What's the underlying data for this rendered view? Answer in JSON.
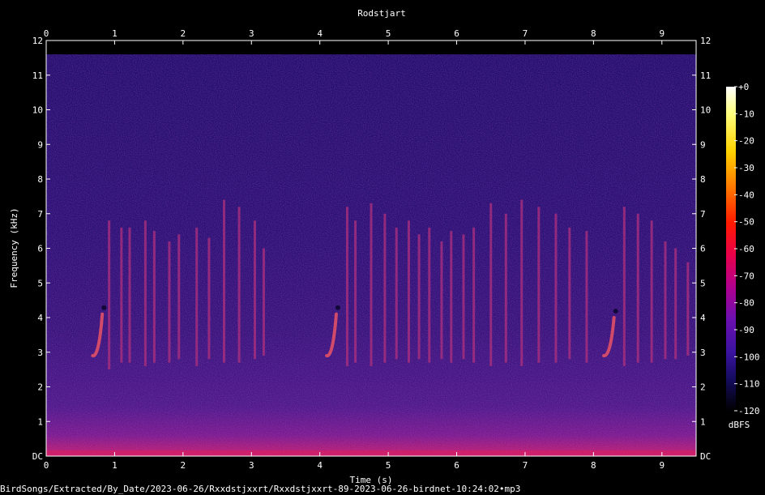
{
  "chart_data": {
    "type": "heatmap",
    "title": "Rodstjart",
    "xlabel": "Time (s)",
    "ylabel": "Frequency (kHz)",
    "xlim": [
      0,
      9.5
    ],
    "ylim": [
      0,
      12
    ],
    "x_ticks": [
      "0",
      "1",
      "2",
      "3",
      "4",
      "5",
      "6",
      "7",
      "8",
      "9"
    ],
    "y_ticks": [
      "DC",
      "1",
      "2",
      "3",
      "4",
      "5",
      "6",
      "7",
      "8",
      "9",
      "10",
      "11",
      "12"
    ],
    "colorbar": {
      "label": "dBFS",
      "ticks": [
        "+0",
        "-10",
        "-20",
        "-30",
        "-40",
        "-50",
        "-60",
        "-70",
        "-80",
        "-90",
        "-100",
        "-110",
        "-120"
      ],
      "range": [
        -120,
        0
      ]
    },
    "energy_cutoff_khz": 11.6,
    "sweeps": [
      {
        "t_start": 0.68,
        "t_end": 0.82,
        "f_start_khz": 2.9,
        "f_end_khz": 4.1
      },
      {
        "t_start": 4.1,
        "t_end": 4.24,
        "f_start_khz": 2.9,
        "f_end_khz": 4.1
      },
      {
        "t_start": 8.15,
        "t_end": 8.3,
        "f_start_khz": 2.9,
        "f_end_khz": 4.0
      }
    ],
    "clicks": [
      {
        "t": 0.92,
        "f_low_khz": 2.5,
        "f_high_khz": 6.8
      },
      {
        "t": 1.1,
        "f_low_khz": 2.7,
        "f_high_khz": 6.6
      },
      {
        "t": 1.22,
        "f_low_khz": 2.7,
        "f_high_khz": 6.6
      },
      {
        "t": 1.45,
        "f_low_khz": 2.6,
        "f_high_khz": 6.8
      },
      {
        "t": 1.58,
        "f_low_khz": 2.7,
        "f_high_khz": 6.5
      },
      {
        "t": 1.8,
        "f_low_khz": 2.7,
        "f_high_khz": 6.2
      },
      {
        "t": 1.94,
        "f_low_khz": 2.8,
        "f_high_khz": 6.4
      },
      {
        "t": 2.2,
        "f_low_khz": 2.6,
        "f_high_khz": 6.6
      },
      {
        "t": 2.38,
        "f_low_khz": 2.8,
        "f_high_khz": 6.3
      },
      {
        "t": 2.6,
        "f_low_khz": 2.7,
        "f_high_khz": 7.4
      },
      {
        "t": 2.82,
        "f_low_khz": 2.7,
        "f_high_khz": 7.2
      },
      {
        "t": 3.05,
        "f_low_khz": 2.8,
        "f_high_khz": 6.8
      },
      {
        "t": 3.18,
        "f_low_khz": 2.9,
        "f_high_khz": 6.0
      },
      {
        "t": 4.4,
        "f_low_khz": 2.6,
        "f_high_khz": 7.2
      },
      {
        "t": 4.52,
        "f_low_khz": 2.7,
        "f_high_khz": 6.8
      },
      {
        "t": 4.75,
        "f_low_khz": 2.6,
        "f_high_khz": 7.3
      },
      {
        "t": 4.95,
        "f_low_khz": 2.7,
        "f_high_khz": 7.0
      },
      {
        "t": 5.12,
        "f_low_khz": 2.8,
        "f_high_khz": 6.6
      },
      {
        "t": 5.3,
        "f_low_khz": 2.7,
        "f_high_khz": 6.8
      },
      {
        "t": 5.45,
        "f_low_khz": 2.8,
        "f_high_khz": 6.4
      },
      {
        "t": 5.6,
        "f_low_khz": 2.7,
        "f_high_khz": 6.6
      },
      {
        "t": 5.78,
        "f_low_khz": 2.8,
        "f_high_khz": 6.2
      },
      {
        "t": 5.92,
        "f_low_khz": 2.7,
        "f_high_khz": 6.5
      },
      {
        "t": 6.1,
        "f_low_khz": 2.8,
        "f_high_khz": 6.4
      },
      {
        "t": 6.25,
        "f_low_khz": 2.7,
        "f_high_khz": 6.6
      },
      {
        "t": 6.5,
        "f_low_khz": 2.6,
        "f_high_khz": 7.3
      },
      {
        "t": 6.72,
        "f_low_khz": 2.7,
        "f_high_khz": 7.0
      },
      {
        "t": 6.95,
        "f_low_khz": 2.6,
        "f_high_khz": 7.4
      },
      {
        "t": 7.2,
        "f_low_khz": 2.7,
        "f_high_khz": 7.2
      },
      {
        "t": 7.45,
        "f_low_khz": 2.7,
        "f_high_khz": 7.0
      },
      {
        "t": 7.65,
        "f_low_khz": 2.8,
        "f_high_khz": 6.6
      },
      {
        "t": 7.9,
        "f_low_khz": 2.7,
        "f_high_khz": 6.5
      },
      {
        "t": 8.45,
        "f_low_khz": 2.6,
        "f_high_khz": 7.2
      },
      {
        "t": 8.65,
        "f_low_khz": 2.7,
        "f_high_khz": 7.0
      },
      {
        "t": 8.85,
        "f_low_khz": 2.7,
        "f_high_khz": 6.8
      },
      {
        "t": 9.05,
        "f_low_khz": 2.8,
        "f_high_khz": 6.2
      },
      {
        "t": 9.2,
        "f_low_khz": 2.8,
        "f_high_khz": 6.0
      },
      {
        "t": 9.38,
        "f_low_khz": 2.9,
        "f_high_khz": 5.6
      }
    ],
    "grid": false
  },
  "filename": "BirdSongs/Extracted/By_Date/2023-06-26/Rxxdstjxxrt/Rxxdstjxxrt-89-2023-06-26-birdnet-10:24:02•mp3",
  "colors": {
    "background": "#000000",
    "noise": "#2d1473",
    "noise_dark": "#1c0d5a",
    "band_low": "#5a1a8e",
    "band_dc": "#c01878",
    "call": "#b0307e",
    "sweep": "#d14a6a",
    "axis": "#ffffff"
  }
}
